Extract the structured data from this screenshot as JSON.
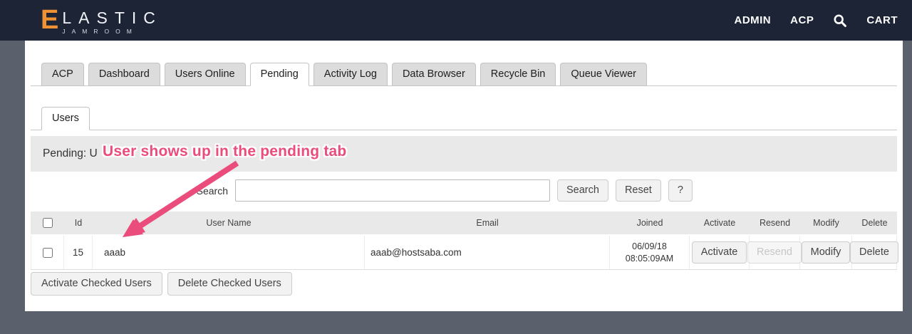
{
  "header": {
    "brand": {
      "initial": "E",
      "rest": "LASTIC",
      "sub": "JAMROOM"
    },
    "nav": {
      "admin": "ADMIN",
      "acp": "ACP",
      "cart": "CART",
      "search_icon": "search-icon"
    }
  },
  "tabs": {
    "items": [
      "ACP",
      "Dashboard",
      "Users Online",
      "Pending",
      "Activity Log",
      "Data Browser",
      "Recycle Bin",
      "Queue Viewer"
    ],
    "active": "Pending"
  },
  "subtabs": {
    "items": [
      "Users"
    ],
    "active": "Users"
  },
  "section": {
    "title": "Pending: U"
  },
  "annotation": {
    "text": "User shows up in the pending tab",
    "color": "#ea4c7c"
  },
  "search": {
    "label": "Search",
    "value": "",
    "placeholder": "",
    "buttons": {
      "search": "Search",
      "reset": "Reset",
      "help": "?"
    }
  },
  "table": {
    "columns": [
      "Id",
      "User Name",
      "Email",
      "Joined",
      "Activate",
      "Resend",
      "Modify",
      "Delete"
    ],
    "rows": [
      {
        "id": "15",
        "username": "aaab",
        "email": "aaab@hostsaba.com",
        "joined_date": "06/09/18",
        "joined_time": "08:05:09AM",
        "actions": {
          "activate": "Activate",
          "resend": "Resend",
          "modify": "Modify",
          "delete": "Delete"
        },
        "resend_disabled": true,
        "checked": false
      }
    ]
  },
  "footer": {
    "activate_checked": "Activate Checked Users",
    "delete_checked": "Delete Checked Users"
  },
  "colors": {
    "header_bg": "#1d2436",
    "accent_orange": "#ef9234",
    "page_bg": "#5b616c",
    "annotation_pink": "#ea4c7c",
    "tab_inactive_bg": "#dcdcdc",
    "section_bar_bg": "#e9e9e9"
  }
}
